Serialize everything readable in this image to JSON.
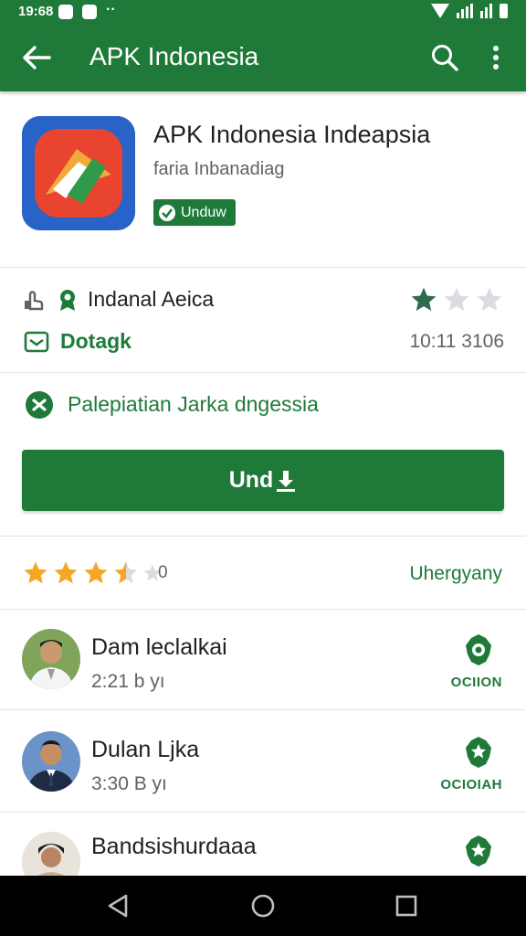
{
  "status_bar": {
    "time": "19:68"
  },
  "app_bar": {
    "title": "APK Indonesia"
  },
  "app": {
    "name": "APK Indonesia  Indeapsia",
    "developer": "faria Inbanadiag",
    "badge_label": "Unduw"
  },
  "meta": {
    "row1_text": "Indanal Aeica",
    "row1_stars_filled": 1,
    "row1_stars_total": 3,
    "row2_text": "Dotagk",
    "row2_value": "10:11 3106"
  },
  "permission_text": "Palepiatian Jarka dngessia",
  "install_label": "Und",
  "rating": {
    "stars": 3.5,
    "value_text": "0",
    "link_label": "Uhergyany"
  },
  "reviews": [
    {
      "name": "Dam leclalkai",
      "time": "2:21 b yı",
      "label": "OCIION"
    },
    {
      "name": "Dulan Ljka",
      "time": "3:30 B yı",
      "label": "OCIOIAH"
    },
    {
      "name": "Bandsishurdaaa",
      "time": "",
      "label": ""
    }
  ],
  "colors": {
    "primary": "#1f7a3a",
    "star": "#f5a623",
    "dark_star": "#2e6b4f"
  }
}
